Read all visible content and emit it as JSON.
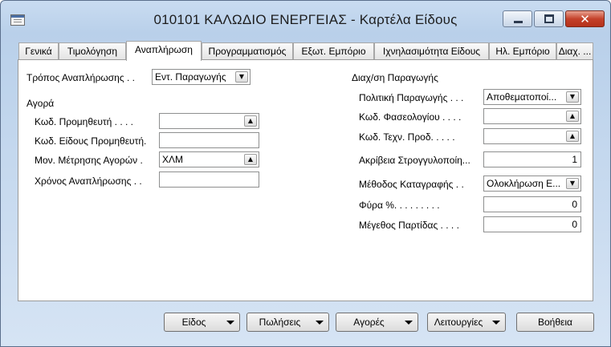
{
  "window": {
    "title": "010101 ΚΑΛΩΔΙΟ ΕΝΕΡΓΕΙΑΣ - Καρτέλα Είδους"
  },
  "tabs": [
    "Γενικά",
    "Τιμολόγηση",
    "Αναπλήρωση",
    "Προγραμματισμός",
    "Εξωτ. Εμπόριο",
    "Ιχνηλασιμότητα Είδους",
    "Ηλ. Εμπόριο",
    "Διαχ. ..."
  ],
  "left": {
    "replenishment_label": "Τρόπος Αναπλήρωσης . .",
    "replenishment_value": "Εντ. Παραγωγής",
    "purchase_heading": "Αγορά",
    "vendor_no_label": "Κωδ. Προμηθευτή . . . .",
    "vendor_no_value": "",
    "vendor_item_label": "Κωδ. Είδους Προμηθευτή.",
    "vendor_item_value": "",
    "purch_uom_label": "Μον. Μέτρησης Αγορών .",
    "purch_uom_value": "ΧΛΜ",
    "lead_time_label": "Χρόνος Αναπλήρωσης . .",
    "lead_time_value": ""
  },
  "right": {
    "production_heading": "Διαχ/ση Παραγωγής",
    "mfg_policy_label": "Πολιτική Παραγωγής . . .",
    "mfg_policy_value": "Αποθεματοποί...",
    "routing_label": "Κωδ. Φασεολογίου . . . .",
    "routing_value": "",
    "bom_label": "Κωδ. Τεχν. Προδ. . . . .",
    "bom_value": "",
    "rounding_label": "Ακρίβεια Στρογγυλοποίη...",
    "rounding_value": "1",
    "flushing_label": "Μέθοδος Καταγραφής . .",
    "flushing_value": "Ολοκλήρωση Ε...",
    "scrap_label": "Φύρα %. . . . . . . . .",
    "scrap_value": "0",
    "lot_size_label": "Μέγεθος Παρτίδας . . . .",
    "lot_size_value": "0"
  },
  "buttons": {
    "item": "Είδος",
    "sales": "Πωλήσεις",
    "purchases": "Αγορές",
    "functions": "Λειτουργίες",
    "help": "Βοήθεια"
  },
  "icons": {
    "window_controls": [
      "minimize-icon",
      "maximize-icon",
      "close-icon"
    ],
    "lookup": "lookup-arrow-icon",
    "dropdown": "dropdown-arrow-icon"
  },
  "colors": {
    "titlebar": "#c9dcf1",
    "panel": "#ffffff",
    "close_button": "#c4422b"
  }
}
